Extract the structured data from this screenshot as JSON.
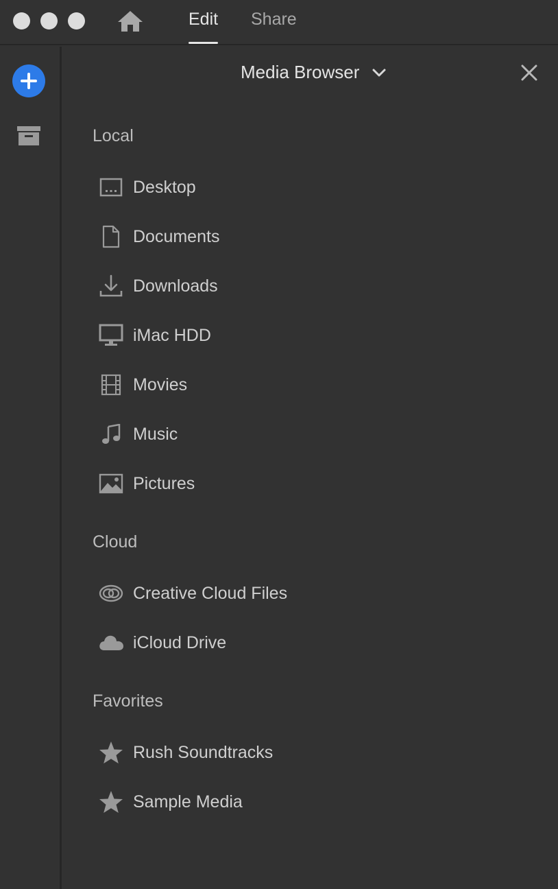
{
  "topbar": {
    "tabs": [
      {
        "label": "Edit",
        "active": true
      },
      {
        "label": "Share",
        "active": false
      }
    ],
    "home_icon": "home-icon"
  },
  "leftrail": {
    "add_icon": "plus-icon",
    "archive_icon": "archive-icon",
    "accent": "#2d7be8"
  },
  "panel": {
    "title": "Media Browser",
    "sections": [
      {
        "title": "Local",
        "items": [
          {
            "label": "Desktop",
            "icon": "desktop-icon"
          },
          {
            "label": "Documents",
            "icon": "document-icon"
          },
          {
            "label": "Downloads",
            "icon": "download-icon"
          },
          {
            "label": "iMac HDD",
            "icon": "monitor-icon"
          },
          {
            "label": "Movies",
            "icon": "film-icon"
          },
          {
            "label": "Music",
            "icon": "music-note-icon"
          },
          {
            "label": "Pictures",
            "icon": "image-icon"
          }
        ]
      },
      {
        "title": "Cloud",
        "items": [
          {
            "label": "Creative Cloud Files",
            "icon": "creative-cloud-icon"
          },
          {
            "label": "iCloud Drive",
            "icon": "cloud-icon"
          }
        ]
      },
      {
        "title": "Favorites",
        "items": [
          {
            "label": "Rush Soundtracks",
            "icon": "star-icon"
          },
          {
            "label": "Sample Media",
            "icon": "star-icon"
          }
        ]
      }
    ]
  }
}
